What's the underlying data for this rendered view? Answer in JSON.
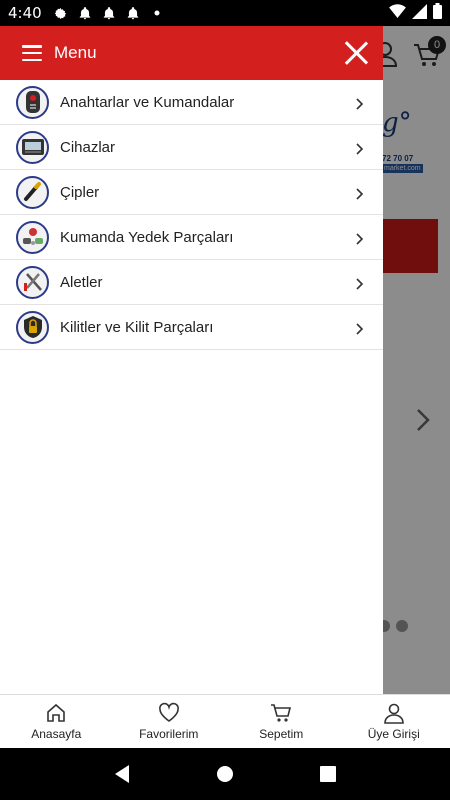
{
  "status_bar": {
    "time": "4:40",
    "icons": [
      "gear-icon",
      "bell-icon",
      "bell-icon",
      "bell-icon",
      "dot-icon"
    ],
    "right_icons": [
      "wifi-icon",
      "signal-icon",
      "battery-icon"
    ]
  },
  "background": {
    "cart_badge": "0",
    "banner_logo_fragment": "g°",
    "banner_phone_fragment": "72 70 07",
    "banner_web_fragment": "market.com"
  },
  "drawer": {
    "title": "Menu",
    "items": [
      {
        "label": "Anahtarlar ve Kumandalar",
        "icon": "car-key-icon"
      },
      {
        "label": "Cihazlar",
        "icon": "device-icon"
      },
      {
        "label": "Çipler",
        "icon": "chip-icon"
      },
      {
        "label": "Kumanda Yedek Parçaları",
        "icon": "remote-parts-icon"
      },
      {
        "label": "Aletler",
        "icon": "tools-icon"
      },
      {
        "label": "Kilitler ve Kilit Parçaları",
        "icon": "lock-icon"
      }
    ]
  },
  "bottom_nav": {
    "items": [
      {
        "label": "Anasayfa",
        "icon": "home-icon"
      },
      {
        "label": "Favorilerim",
        "icon": "heart-icon"
      },
      {
        "label": "Sepetim",
        "icon": "cart-icon"
      },
      {
        "label": "Üye Girişi",
        "icon": "user-icon"
      }
    ]
  },
  "colors": {
    "accent": "#d41f1f",
    "icon_ring": "#2c3a8a"
  }
}
